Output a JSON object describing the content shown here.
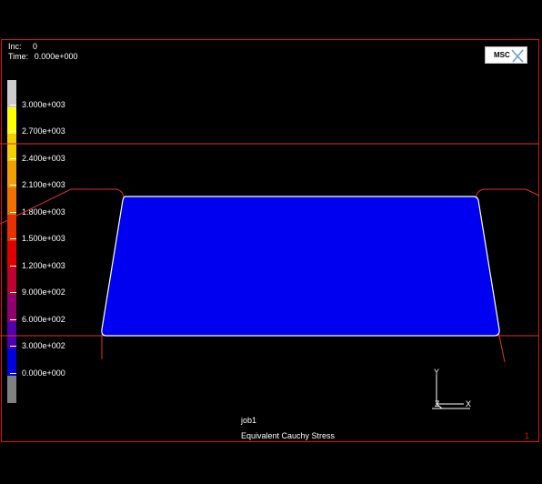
{
  "header": {
    "inc_label": "Inc:",
    "inc_value": "0",
    "time_label": "Time:",
    "time_value": "0.000e+000"
  },
  "logo": {
    "text": "MSC"
  },
  "legend": {
    "labels": [
      "3.000e+003",
      "2.700e+003",
      "2.400e+003",
      "2.100e+003",
      "1.800e+003",
      "1.500e+003",
      "1.200e+003",
      "9.000e+002",
      "6.000e+002",
      "3.000e+002",
      "0.000e+000"
    ],
    "colors": [
      "#cccccc",
      "#ffff00",
      "#f0d000",
      "#f0a000",
      "#f07000",
      "#e83000",
      "#e00000",
      "#c00030",
      "#900070",
      "#5000b0",
      "#0000e0",
      "#808080"
    ]
  },
  "footer": {
    "job_name": "job1",
    "result_label": "Equivalent Cauchy Stress",
    "page_number": "1"
  },
  "triad": {
    "x_label": "X",
    "y_label": "Y",
    "z_label": "Z"
  },
  "colors": {
    "frame": "#e01010",
    "mesh": "#0000f0",
    "contact": "#e03030",
    "outline": "#ffffff"
  }
}
